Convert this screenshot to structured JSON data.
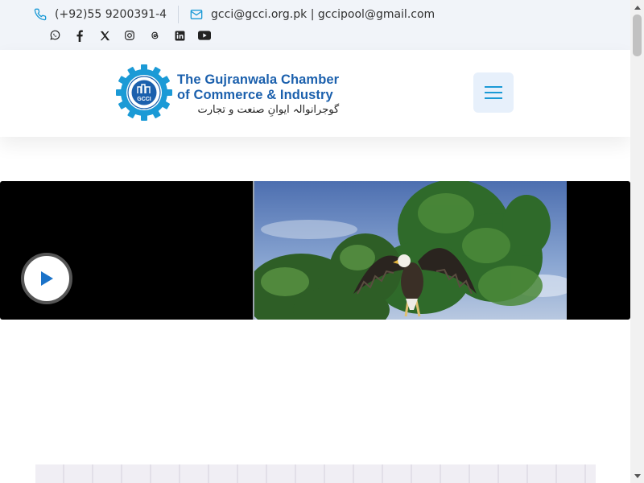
{
  "contact": {
    "phone": "(+92)55 9200391-4",
    "email": "gcci@gcci.org.pk | gccipool@gmail.com"
  },
  "social": [
    "whatsapp-icon",
    "facebook-icon",
    "x-icon",
    "instagram-icon",
    "threads-icon",
    "linkedin-icon",
    "youtube-icon"
  ],
  "logo": {
    "line1": "The Gujranwala Chamber",
    "line2": "of Commerce & Industry",
    "urdu": "گوجرانوالہ ایوانِ صنعت و تجارت",
    "emblem": "GCCI"
  },
  "colors": {
    "accent": "#1b9ad6",
    "brand": "#1b60ad",
    "topbar_bg": "#f1f4f9",
    "menu_bg": "#e7f0fb"
  },
  "video": {
    "play_icon": "play-icon"
  }
}
